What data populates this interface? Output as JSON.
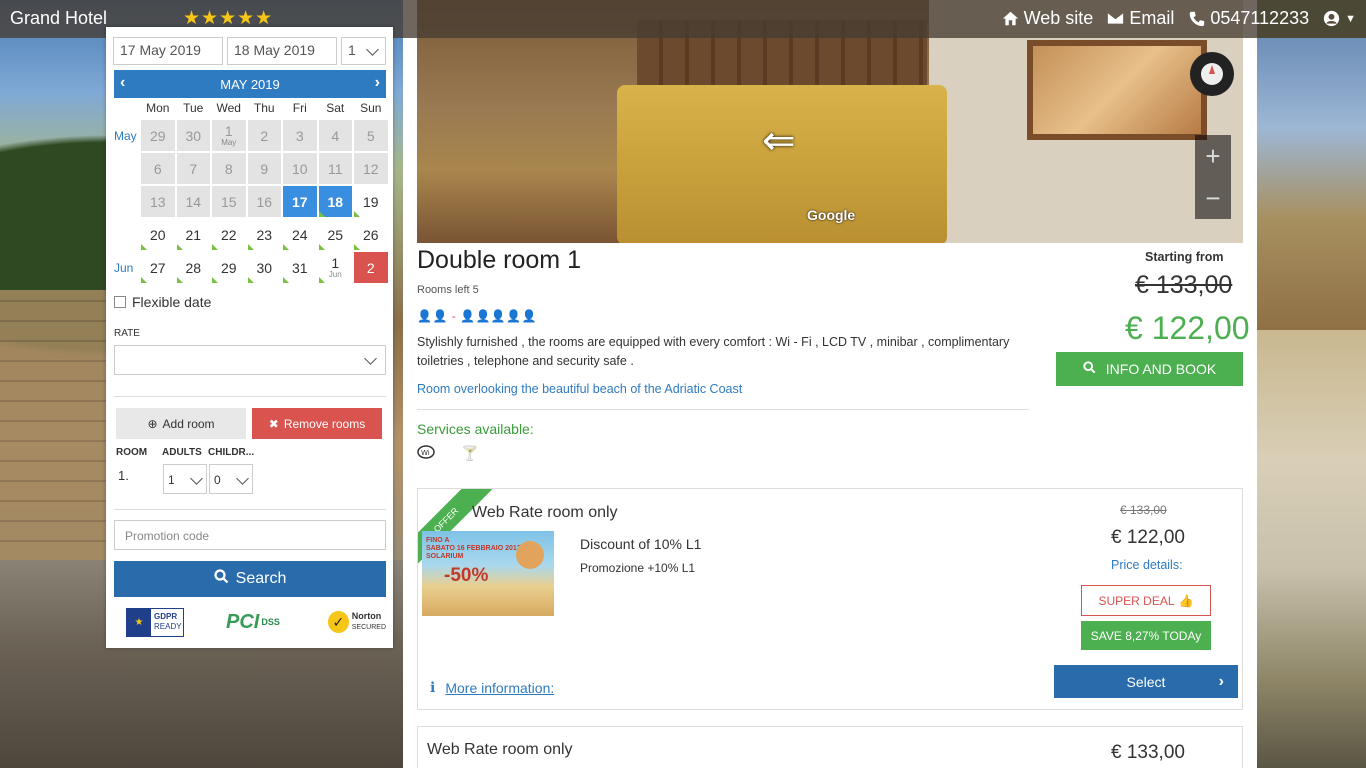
{
  "header": {
    "brand": "Grand Hotel",
    "stars": "★★★★★",
    "website_label": "Web site",
    "email_label": "Email",
    "phone": "0547112233"
  },
  "booking": {
    "checkin": "17 May 2019",
    "checkout": "18 May 2019",
    "nights": "1",
    "calendar": {
      "month_label": "MAY 2019",
      "dows": [
        "Mon",
        "Tue",
        "Wed",
        "Thu",
        "Fri",
        "Sat",
        "Sun"
      ],
      "weeks": [
        {
          "month": "May",
          "days": [
            {
              "n": "29",
              "s": "past"
            },
            {
              "n": "30",
              "s": "past"
            },
            {
              "n": "1",
              "s": "past",
              "mini": "May"
            },
            {
              "n": "2",
              "s": "past"
            },
            {
              "n": "3",
              "s": "past"
            },
            {
              "n": "4",
              "s": "past"
            },
            {
              "n": "5",
              "s": "past"
            }
          ]
        },
        {
          "month": "",
          "days": [
            {
              "n": "6",
              "s": "past"
            },
            {
              "n": "7",
              "s": "past"
            },
            {
              "n": "8",
              "s": "past"
            },
            {
              "n": "9",
              "s": "past"
            },
            {
              "n": "10",
              "s": "past"
            },
            {
              "n": "11",
              "s": "past"
            },
            {
              "n": "12",
              "s": "past"
            }
          ]
        },
        {
          "month": "",
          "days": [
            {
              "n": "13",
              "s": "past"
            },
            {
              "n": "14",
              "s": "past"
            },
            {
              "n": "15",
              "s": "past"
            },
            {
              "n": "16",
              "s": "past"
            },
            {
              "n": "17",
              "s": "sel"
            },
            {
              "n": "18",
              "s": "sel avail"
            },
            {
              "n": "19",
              "s": "avail"
            }
          ]
        },
        {
          "month": "",
          "days": [
            {
              "n": "20",
              "s": "avail"
            },
            {
              "n": "21",
              "s": "avail"
            },
            {
              "n": "22",
              "s": "avail"
            },
            {
              "n": "23",
              "s": "avail"
            },
            {
              "n": "24",
              "s": "avail"
            },
            {
              "n": "25",
              "s": "avail"
            },
            {
              "n": "26",
              "s": "avail"
            }
          ]
        },
        {
          "month": "Jun",
          "days": [
            {
              "n": "27",
              "s": "avail"
            },
            {
              "n": "28",
              "s": "avail"
            },
            {
              "n": "29",
              "s": "avail"
            },
            {
              "n": "30",
              "s": "avail"
            },
            {
              "n": "31",
              "s": "avail"
            },
            {
              "n": "1",
              "s": "avail",
              "mini": "Jun"
            },
            {
              "n": "2",
              "s": "busy"
            }
          ]
        }
      ]
    },
    "flexible_date_label": "Flexible date",
    "rate_label": "RATE",
    "add_room_label": "Add room",
    "remove_rooms_label": "Remove rooms",
    "room_col": "ROOM",
    "adults_col": "ADULTS",
    "children_col": "CHILDR...",
    "room_number": "1.",
    "adults_value": "1",
    "children_value": "0",
    "promo_placeholder": "Promotion code",
    "search_label": "Search",
    "gdpr_title": "GDPR",
    "gdpr_sub": "READY",
    "pci_label": "PCI",
    "pci_sub": "DSS",
    "norton_title": "Norton",
    "norton_sub": "SECURED"
  },
  "room": {
    "google_label": "Google",
    "title": "Double room 1",
    "rooms_left": "Rooms left 5",
    "persons": "👤👤 - 👤👤👤👤👤",
    "description": "Stylishly furnished , the rooms are equipped with every comfort : Wi - Fi , LCD TV , minibar , complimentary toiletries , telephone and security safe .",
    "overlook": "Room overlooking the beautiful beach of the Adriatic Coast",
    "services_label": "Services available:",
    "starting_from": "Starting from",
    "old_price": "€ 133,00",
    "new_price": "€ 122,00",
    "info_book_label": "INFO AND BOOK"
  },
  "offer": {
    "ribbon": "OFFER",
    "title": "Web Rate room only",
    "img_line1": "FINO A",
    "img_line2": "SABATO 16 FEBBRAIO 2013",
    "img_line3": "SOLARIUM",
    "img_discount": "-50%",
    "name": "Discount of 10% L1",
    "sub": "Promozione +10% L1",
    "old_price": "€ 133,00",
    "new_price": "€ 122,00",
    "price_details": "Price details:",
    "super_deal": "SUPER DEAL",
    "save_today": "SAVE 8,27% TODAy",
    "select_label": "Select",
    "more_info": "More information:"
  },
  "offer2": {
    "title": "Web Rate room only",
    "price": "€ 133,00"
  }
}
